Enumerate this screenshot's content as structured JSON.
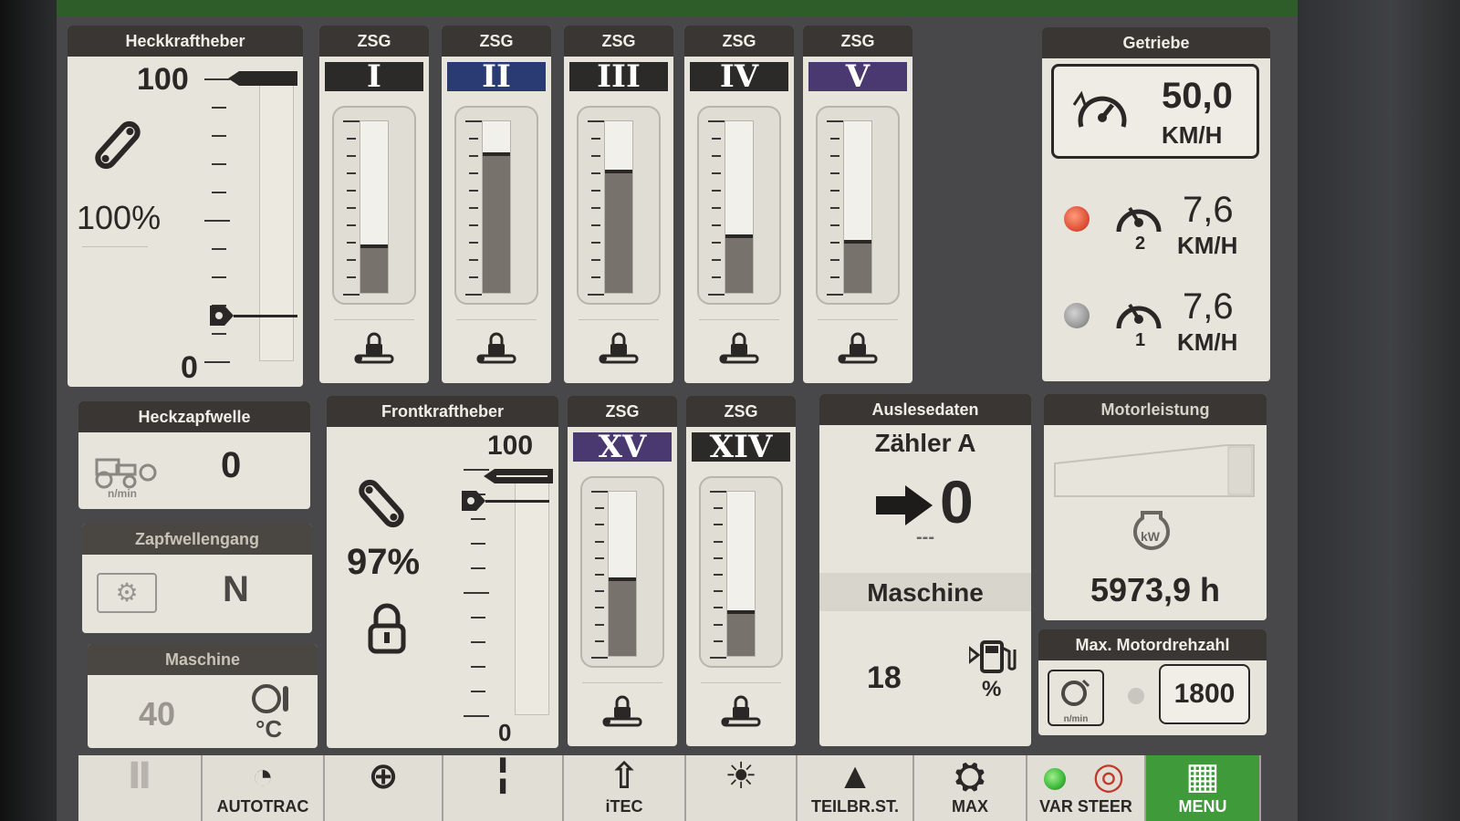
{
  "heckkraftheber": {
    "title": "Heckkraftheber",
    "max": "100",
    "min": "0",
    "percent": "100%",
    "level": 1.0,
    "setpoint": 0.16
  },
  "zsg_top": [
    {
      "title": "ZSG",
      "roman": "I",
      "level": 0.28,
      "style": "dark"
    },
    {
      "title": "ZSG",
      "roman": "II",
      "level": 0.82,
      "style": "blue"
    },
    {
      "title": "ZSG",
      "roman": "III",
      "level": 0.72,
      "style": "dark"
    },
    {
      "title": "ZSG",
      "roman": "IV",
      "level": 0.34,
      "style": "dark"
    },
    {
      "title": "ZSG",
      "roman": "V",
      "level": 0.31,
      "style": "purple"
    }
  ],
  "getriebe": {
    "title": "Getriebe",
    "main_speed": "50,0",
    "main_unit": "KM/H",
    "speed2": "7,6",
    "speed2_unit": "KM/H",
    "speed2_index": "2",
    "speed1": "7,6",
    "speed1_unit": "KM/H",
    "speed1_index": "1",
    "colors": {
      "active_led": "#e0533a",
      "inactive_led": "#9b9b9b"
    }
  },
  "heckzapfwelle": {
    "title": "Heckzapfwelle",
    "value": "0",
    "unit": "n/min"
  },
  "zapfwellengang": {
    "title": "Zapfwellengang",
    "value": "N"
  },
  "maschine_temp": {
    "title": "Maschine",
    "value": "40",
    "unit": "°C"
  },
  "frontkraftheber": {
    "title": "Frontkraftheber",
    "max": "100",
    "min": "0",
    "percent": "97%",
    "level": 0.97,
    "setpoint": 0.87
  },
  "zsg_bottom": [
    {
      "title": "ZSG",
      "roman": "XV",
      "level": 0.48,
      "style": "purple"
    },
    {
      "title": "ZSG",
      "roman": "XIV",
      "level": 0.28,
      "style": "dark"
    }
  ],
  "auslesedaten": {
    "title": "Auslesedaten",
    "counter_label": "Zähler A",
    "counter_value": "0",
    "dashes": "---",
    "machine_label": "Maschine",
    "machine_value": "18",
    "machine_unit": "%"
  },
  "motorleistung": {
    "title": "Motorleistung",
    "hours": "5973,9 h",
    "unit": "kW"
  },
  "max_drehzahl": {
    "title": "Max. Motordrehzahl",
    "value": "1800",
    "unit": "n/min"
  },
  "toolbar": [
    {
      "label": "",
      "icon": "pause-icon"
    },
    {
      "label": "AUTOTRAC",
      "icon": "autotrac-icon"
    },
    {
      "label": "",
      "icon": "compass-icon"
    },
    {
      "label": "",
      "icon": "hitch-icon"
    },
    {
      "label": "iTEC",
      "icon": "itec-icon"
    },
    {
      "label": "",
      "icon": "brightness-volume-icon"
    },
    {
      "label": "TEILBR.ST.",
      "icon": "section-control-icon"
    },
    {
      "label": "MAX",
      "icon": "max-icon"
    },
    {
      "label": "VAR STEER",
      "icon": "steering-icon"
    },
    {
      "label": "MENU",
      "icon": "menu-grid-icon"
    }
  ]
}
